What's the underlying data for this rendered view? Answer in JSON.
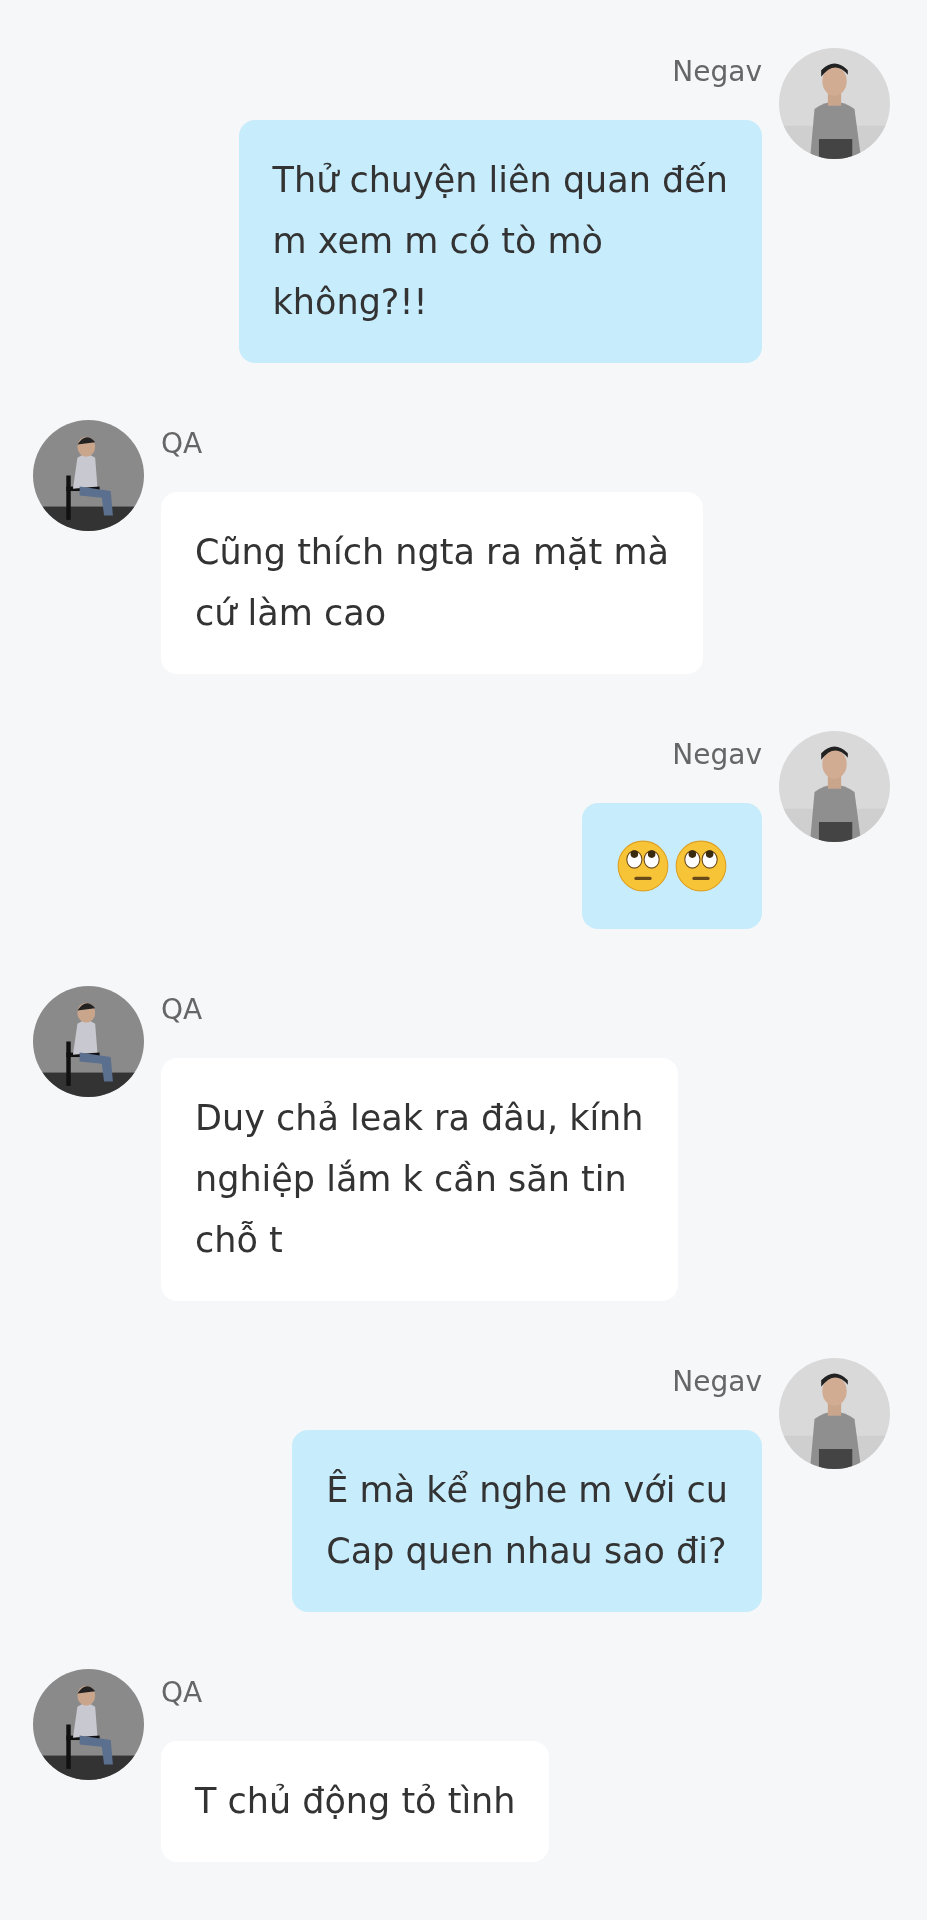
{
  "messages": [
    {
      "outgoing": true,
      "sender": "Negav",
      "avatar": {
        "kind": "picture"
      },
      "kind": "text",
      "lines": [
        "Thử chuyện liên quan đến",
        "m xem m có tò mò",
        "không?!!"
      ]
    },
    {
      "outgoing": false,
      "sender": "QA",
      "avatar": {
        "kind": "picture"
      },
      "kind": "text",
      "lines": [
        "Cũng thích ngta ra mặt mà",
        "cứ làm cao"
      ]
    },
    {
      "outgoing": true,
      "sender": "Negav",
      "avatar": {
        "kind": "picture"
      },
      "kind": "emoji",
      "emojis": [
        {
          "kind": "eye_roll"
        },
        {
          "kind": "eye_roll"
        }
      ]
    },
    {
      "outgoing": false,
      "sender": "QA",
      "avatar": {
        "kind": "picture"
      },
      "kind": "text",
      "lines": [
        "Duy chả leak ra đâu, kính",
        "nghiệp lắm k cần săn tin",
        "chỗ t"
      ]
    },
    {
      "outgoing": true,
      "sender": "Negav",
      "avatar": {
        "kind": "picture"
      },
      "kind": "text",
      "lines": [
        "Ê mà kể nghe m với cu",
        "Cap quen nhau sao đi?"
      ]
    },
    {
      "outgoing": false,
      "sender": "QA",
      "avatar": {
        "kind": "picture"
      },
      "kind": "text",
      "lines": [
        "T chủ động tỏ tình"
      ]
    }
  ]
}
